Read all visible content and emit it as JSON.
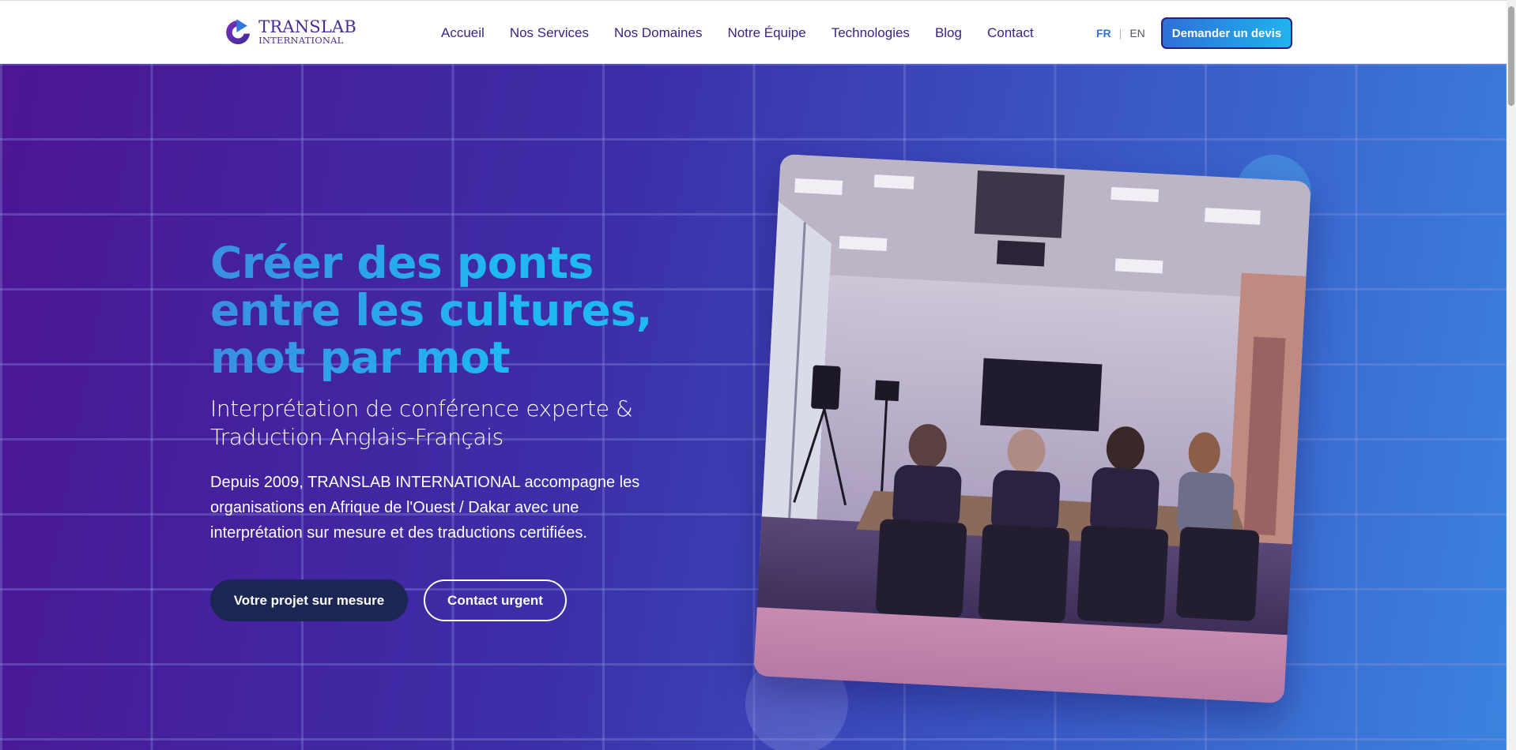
{
  "brand": {
    "name_line1": "TRANSLAB",
    "name_line2": "INTERNATIONAL",
    "logo_icon": "translab-logo-icon",
    "colors": {
      "primary": "#3b1f84",
      "accent": "#2d79d6",
      "button_dark": "#1b2752"
    }
  },
  "nav": {
    "items": [
      {
        "label": "Accueil"
      },
      {
        "label": "Nos Services"
      },
      {
        "label": "Nos Domaines"
      },
      {
        "label": "Notre Équipe"
      },
      {
        "label": "Technologies"
      },
      {
        "label": "Blog"
      },
      {
        "label": "Contact"
      }
    ]
  },
  "lang": {
    "fr": "FR",
    "separator": "|",
    "en": "EN",
    "active": "FR"
  },
  "header": {
    "cta_label": "Demander un devis"
  },
  "hero": {
    "title_line1": "Créer des ponts",
    "title_line2": "entre les cultures,",
    "title_line3": "mot par mot",
    "subtitle_line1": "Interprétation de conférence experte &",
    "subtitle_line2": "Traduction Anglais-Français",
    "desc_line1": "Depuis 2009, TRANSLAB INTERNATIONAL accompagne les",
    "desc_line2": "organisations en Afrique de l'Ouest / Dakar avec une",
    "desc_line3": "interprétation sur mesure et des traductions certifiées.",
    "primary_button": "Votre projet sur mesure",
    "secondary_button": "Contact urgent",
    "image_icon": "conference-room-photo"
  }
}
